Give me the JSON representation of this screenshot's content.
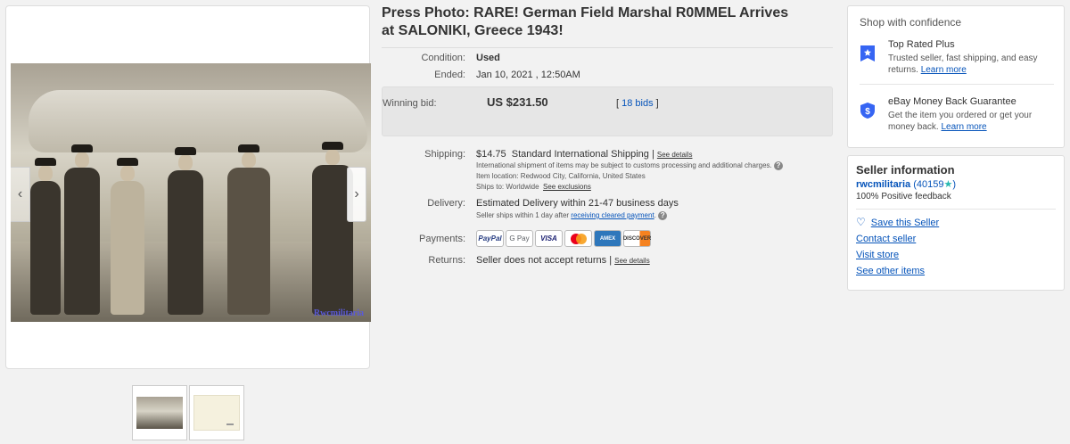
{
  "listing": {
    "title": "Press Photo: RARE! German Field Marshal R0MMEL Arrives at SALONIKI, Greece 1943!",
    "watermark": "Rwcmilitaria",
    "condition_label": "Condition:",
    "condition": "Used",
    "ended_label": "Ended:",
    "ended": "Jan 10, 2021 , 12:50AM",
    "winning_bid_label": "Winning bid:",
    "winning_bid": "US $231.50",
    "bids_open": "[",
    "bids": "18 bids",
    "bids_close": "]",
    "shipping_label": "Shipping:",
    "shipping_cost": "$14.75",
    "shipping_method": "Standard International Shipping |",
    "shipping_details_link": "See details",
    "shipping_note": "International shipment of items may be subject to customs processing and additional charges.",
    "item_location": "Item location:  Redwood City, California, United States",
    "ships_to": "Ships to:  Worldwide",
    "see_exclusions": "See exclusions",
    "delivery_label": "Delivery:",
    "delivery": "Estimated Delivery within 21-47 business days",
    "delivery_note": "Seller ships within 1 day after",
    "delivery_note_link": "receiving cleared payment",
    "delivery_note_end": ".",
    "payments_label": "Payments:",
    "payment_methods": [
      "PayPal",
      "G Pay",
      "VISA",
      "Mastercard",
      "AMEX",
      "DISCOVER"
    ],
    "returns_label": "Returns:",
    "returns": "Seller does not accept returns |",
    "returns_details_link": "See details"
  },
  "confidence": {
    "header": "Shop with confidence",
    "items": [
      {
        "title": "Top Rated Plus",
        "desc": "Trusted seller, fast shipping, and easy returns.",
        "link": "Learn more",
        "icon": "top-rated-badge-icon"
      },
      {
        "title": "eBay Money Back Guarantee",
        "desc": "Get the item you ordered or get your money back.",
        "link": "Learn more",
        "icon": "shield-dollar-icon"
      }
    ]
  },
  "seller": {
    "header": "Seller information",
    "name": "rwcmilitaria",
    "feedback_count": "(40159",
    "feedback_close": ")",
    "feedback": "100% Positive feedback",
    "save": "Save this Seller",
    "contact": "Contact seller",
    "store": "Visit store",
    "other": "See other items"
  },
  "colors": {
    "link": "#0654ba",
    "star": "#29b9b1",
    "icon_blue": "#3665f3"
  }
}
